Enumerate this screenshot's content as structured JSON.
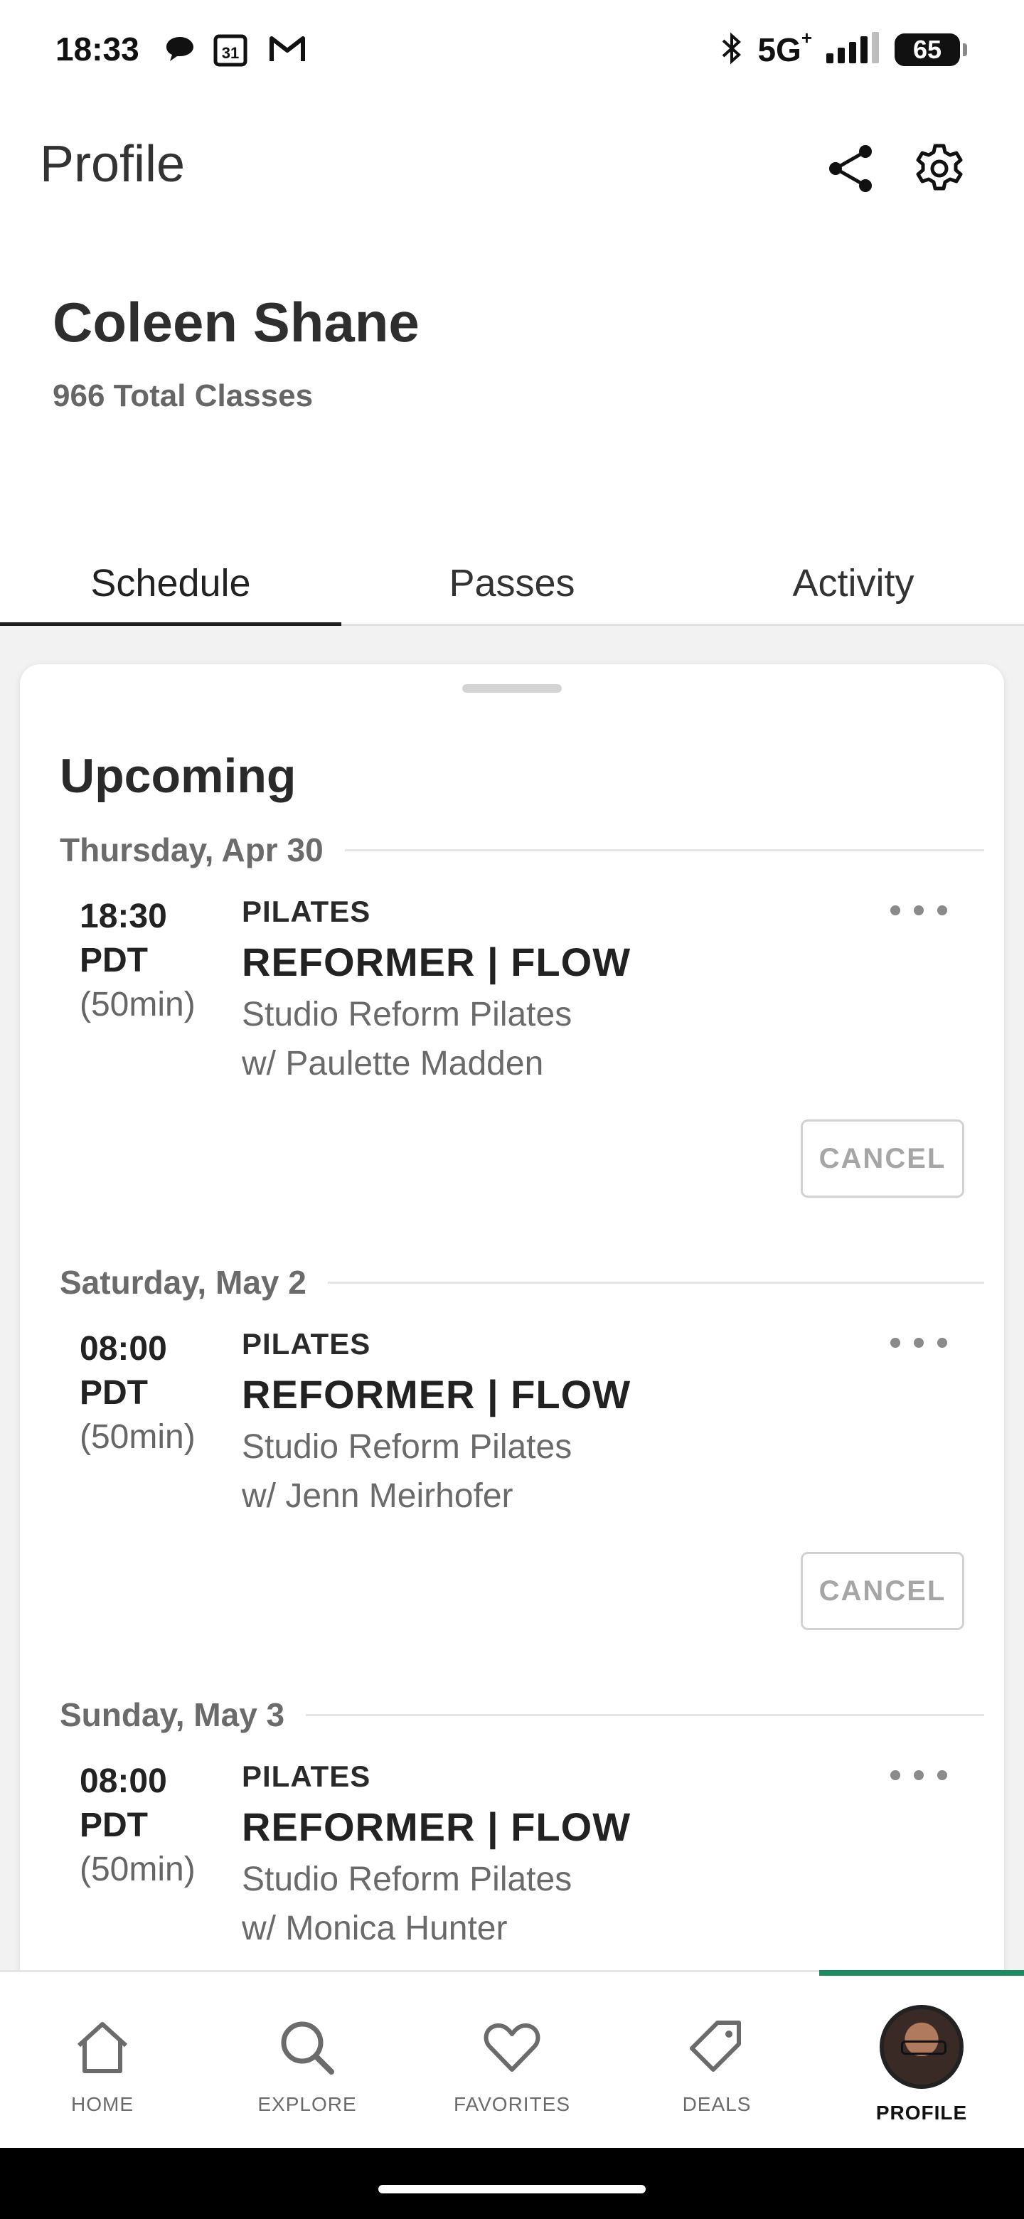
{
  "status_bar": {
    "time": "18:33",
    "calendar_day": "31",
    "network": "5G",
    "network_plus": "+",
    "battery": "65"
  },
  "header": {
    "title": "Profile"
  },
  "profile": {
    "name": "Coleen Shane",
    "total_classes": "966 Total Classes"
  },
  "tabs": [
    {
      "label": "Schedule",
      "active": true
    },
    {
      "label": "Passes",
      "active": false
    },
    {
      "label": "Activity",
      "active": false
    }
  ],
  "schedule": {
    "section_title": "Upcoming",
    "days": [
      {
        "date": "Thursday, Apr 30",
        "time": "18:30",
        "tz": "PDT",
        "duration": "(50min)",
        "category": "PILATES",
        "class_name": "REFORMER | FLOW",
        "studio": "Studio Reform Pilates",
        "instructor": "w/ Paulette Madden",
        "cancel_label": "CANCEL"
      },
      {
        "date": "Saturday, May 2",
        "time": "08:00",
        "tz": "PDT",
        "duration": "(50min)",
        "category": "PILATES",
        "class_name": "REFORMER | FLOW",
        "studio": "Studio Reform Pilates",
        "instructor": "w/ Jenn Meirhofer",
        "cancel_label": "CANCEL"
      },
      {
        "date": "Sunday, May 3",
        "time": "08:00",
        "tz": "PDT",
        "duration": "(50min)",
        "category": "PILATES",
        "class_name": "REFORMER | FLOW",
        "studio": "Studio Reform Pilates",
        "instructor": "w/ Monica Hunter"
      }
    ]
  },
  "bottom_nav": [
    {
      "label": "HOME",
      "icon": "home-icon"
    },
    {
      "label": "EXPLORE",
      "icon": "search-icon"
    },
    {
      "label": "FAVORITES",
      "icon": "heart-icon"
    },
    {
      "label": "DEALS",
      "icon": "tag-icon"
    },
    {
      "label": "PROFILE",
      "icon": "avatar",
      "active": true
    }
  ],
  "colors": {
    "accent": "#1e8a62",
    "text_primary": "#222222",
    "text_secondary": "#6b6b6b",
    "background_gray": "#f2f2f3"
  }
}
